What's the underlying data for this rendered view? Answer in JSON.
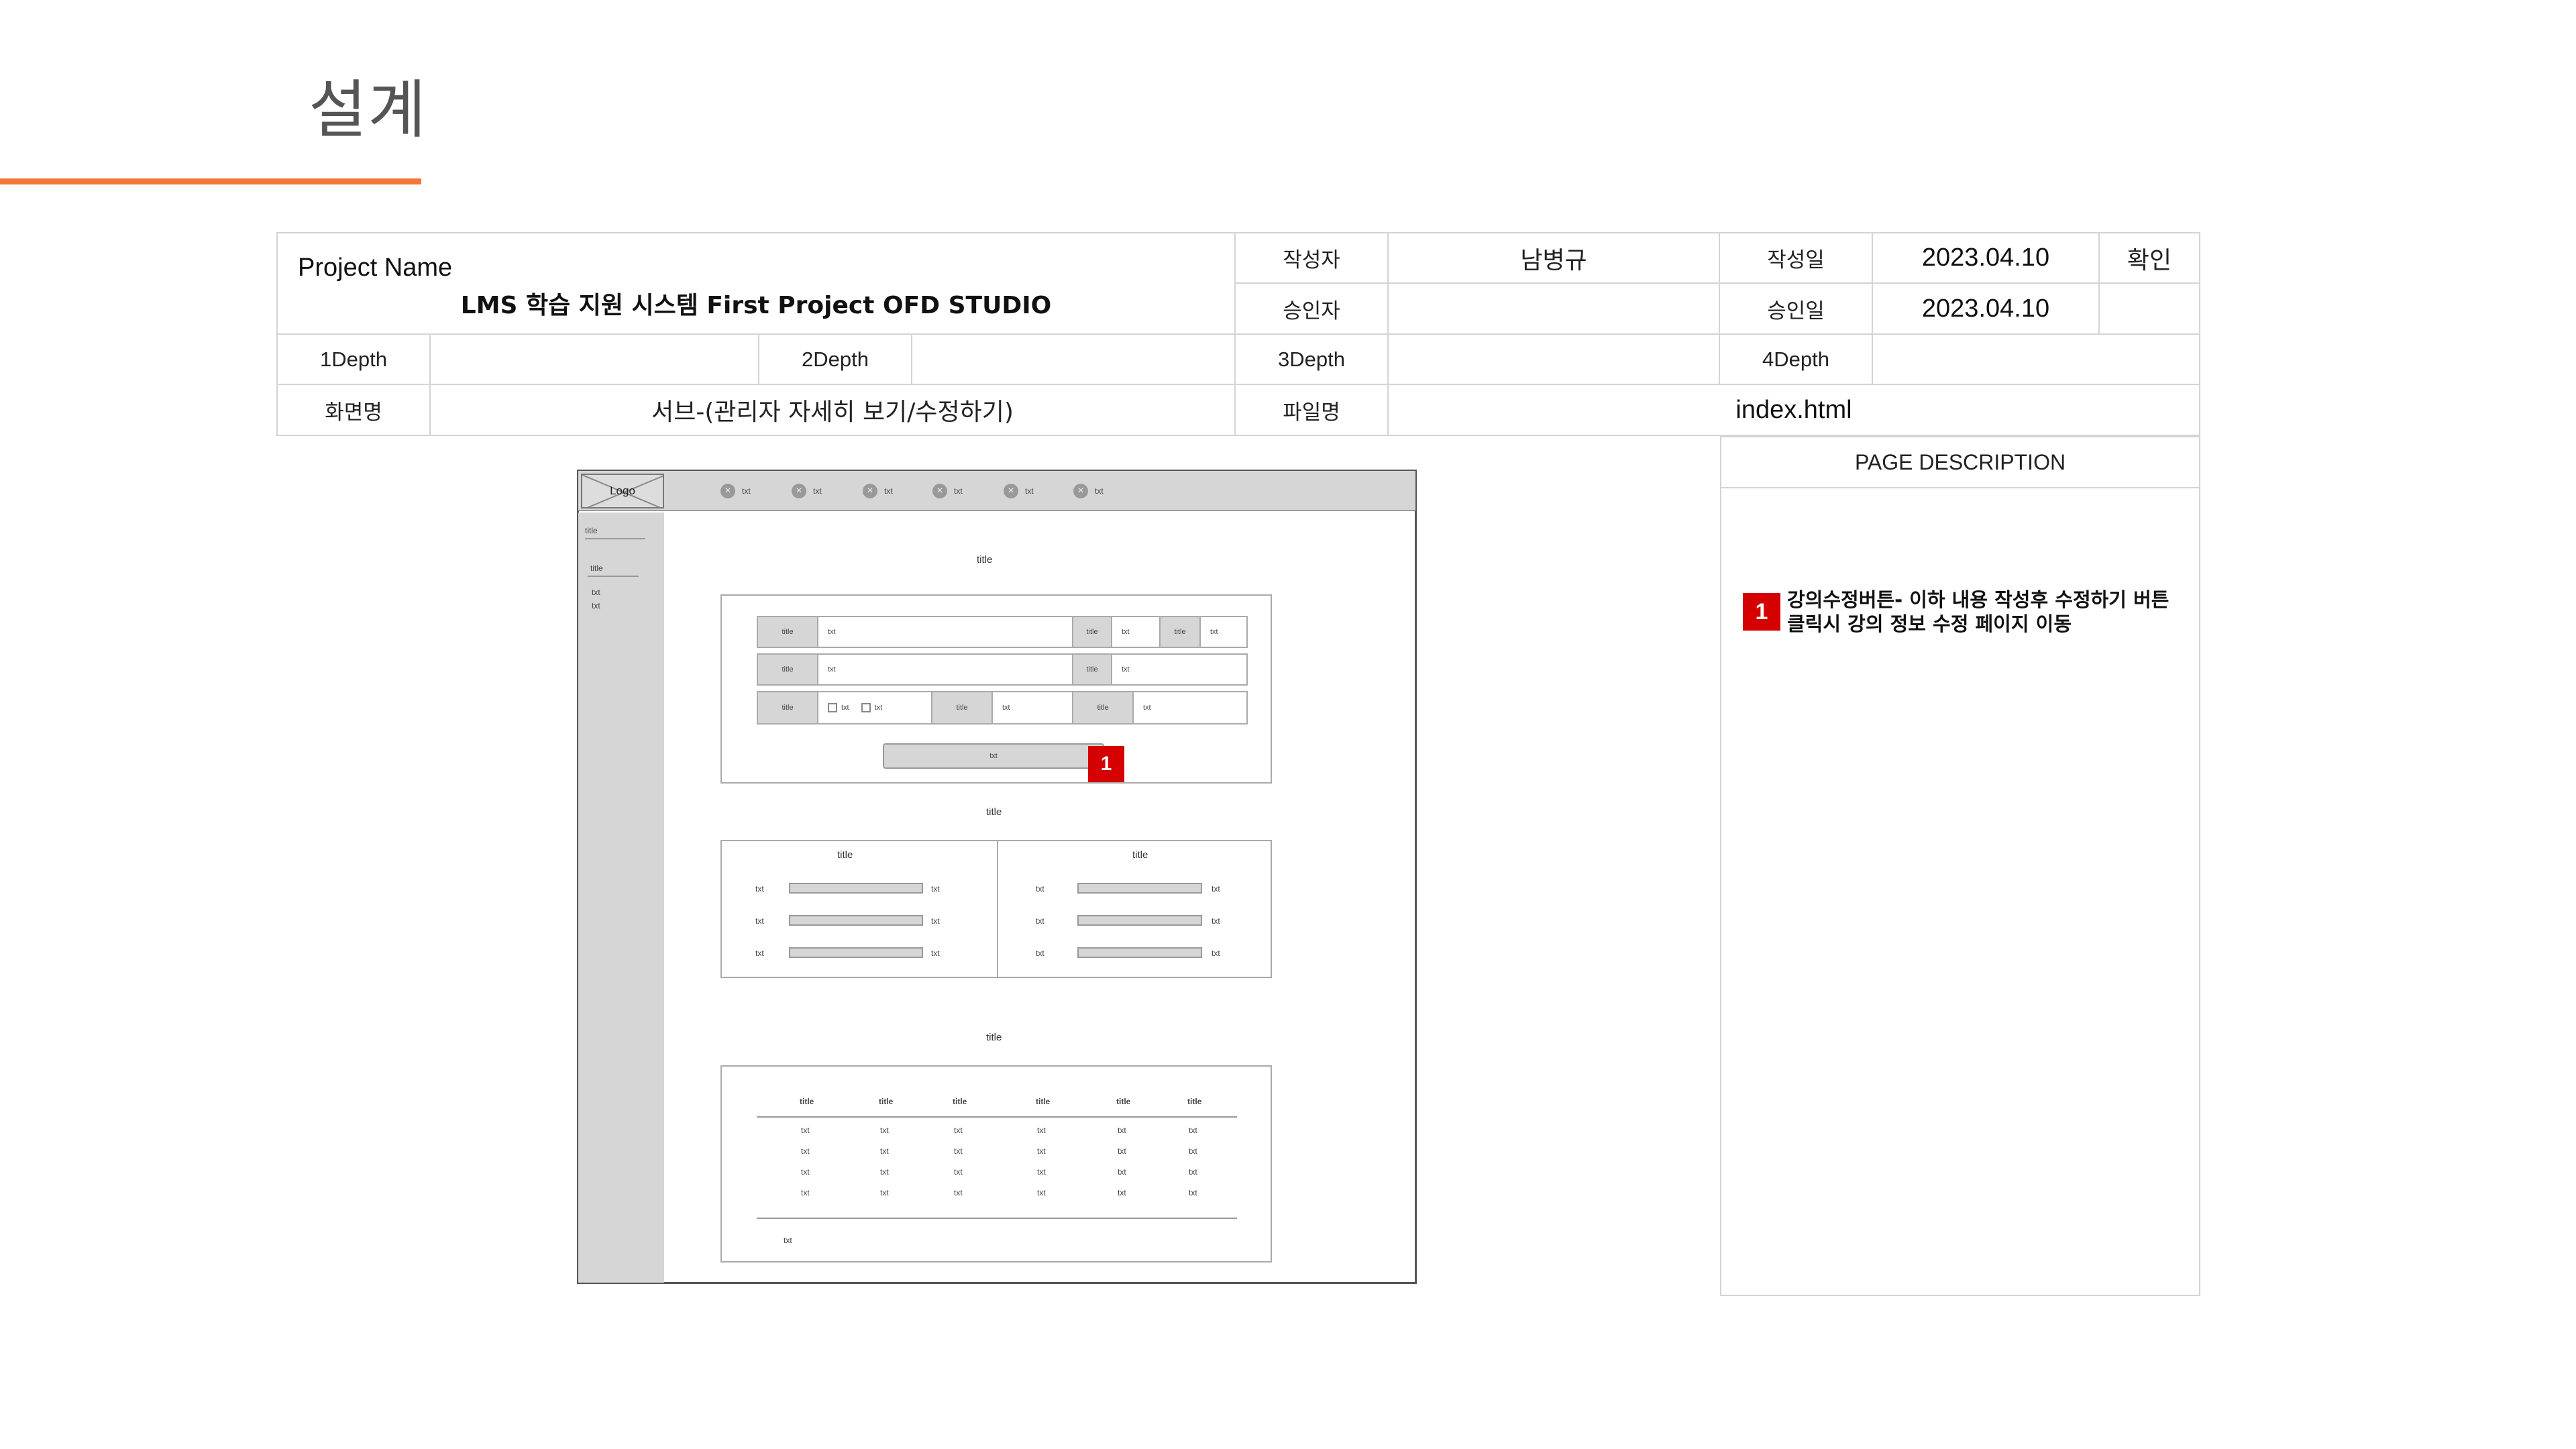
{
  "header": {
    "title": "설계"
  },
  "info": {
    "project_label": "Project Name",
    "project_name": "LMS 학습 지원 시스템 First Project OFD STUDIO",
    "author_label": "작성자",
    "author": "남병규",
    "written_date_label": "작성일",
    "written_date": "2023.04.10",
    "confirm_label": "확인",
    "approver_label": "승인자",
    "approver": "",
    "approved_date_label": "승인일",
    "approved_date": "2023.04.10",
    "depth1_label": "1Depth",
    "depth2_label": "2Depth",
    "depth3_label": "3Depth",
    "depth4_label": "4Depth",
    "screen_label": "화면명",
    "screen_name": "서브-(관리자 자세히 보기/수정하기)",
    "file_label": "파일명",
    "file_name": "index.html"
  },
  "description": {
    "heading": "PAGE DESCRIPTION",
    "items": [
      {
        "number": "1",
        "text": "강의수정버튼- 이하 내용 작성후 수정하기 버튼 클릭시 강의 정보 수정 페이지 이동"
      }
    ]
  },
  "wireframe": {
    "logo": "Logo",
    "nav_items": [
      "txt",
      "txt",
      "txt",
      "txt",
      "txt",
      "txt"
    ],
    "sidebar": {
      "title1": "title",
      "title2": "title",
      "items": [
        "txt",
        "txt"
      ]
    },
    "form_section_title": "title",
    "form_rows": {
      "r1": [
        "title",
        "txt",
        "title",
        "txt",
        "title",
        "txt"
      ],
      "r2": [
        "title",
        "txt",
        "title",
        "txt"
      ],
      "r3": [
        "title",
        "txt",
        "txt",
        "title",
        "txt",
        "title",
        "txt"
      ]
    },
    "form_button": "txt",
    "marker": "1",
    "progress_section_title": "title",
    "progress_panels": [
      {
        "title": "title",
        "rows": [
          [
            "txt",
            "txt"
          ],
          [
            "txt",
            "txt"
          ],
          [
            "txt",
            "txt"
          ]
        ]
      },
      {
        "title": "title",
        "rows": [
          [
            "txt",
            "txt"
          ],
          [
            "txt",
            "txt"
          ],
          [
            "txt",
            "txt"
          ]
        ]
      }
    ],
    "table_section_title": "title",
    "table_headers": [
      "title",
      "title",
      "title",
      "title",
      "title",
      "title"
    ],
    "table_rows": [
      [
        "txt",
        "txt",
        "txt",
        "txt",
        "txt",
        "txt"
      ],
      [
        "txt",
        "txt",
        "txt",
        "txt",
        "txt",
        "txt"
      ],
      [
        "txt",
        "txt",
        "txt",
        "txt",
        "txt",
        "txt"
      ],
      [
        "txt",
        "txt",
        "txt",
        "txt",
        "txt",
        "txt"
      ]
    ],
    "table_footer": "txt"
  }
}
